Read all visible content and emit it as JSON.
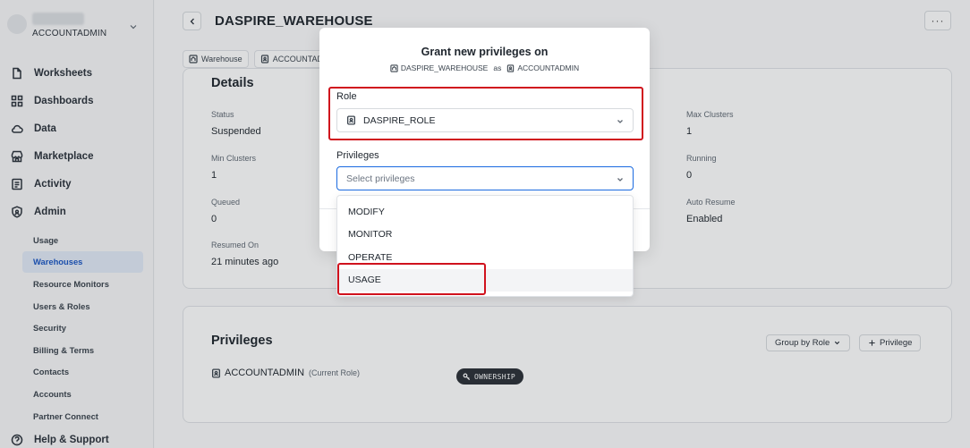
{
  "sidebar": {
    "account_role": "ACCOUNTADMIN",
    "nav": [
      {
        "label": "Worksheets",
        "icon": "worksheet-icon"
      },
      {
        "label": "Dashboards",
        "icon": "dashboard-icon"
      },
      {
        "label": "Data",
        "icon": "cloud-icon"
      },
      {
        "label": "Marketplace",
        "icon": "store-icon"
      },
      {
        "label": "Activity",
        "icon": "activity-icon"
      },
      {
        "label": "Admin",
        "icon": "shield-icon"
      }
    ],
    "admin_items": [
      "Usage",
      "Warehouses",
      "Resource Monitors",
      "Users & Roles",
      "Security",
      "Billing & Terms",
      "Contacts",
      "Accounts",
      "Partner Connect"
    ],
    "active_admin_item": "Warehouses",
    "help_label": "Help & Support"
  },
  "header": {
    "title": "DASPIRE_WAREHOUSE",
    "more_label": "···"
  },
  "breadcrumb": {
    "warehouse_label": "Warehouse",
    "role_label": "ACCOUNTAD"
  },
  "details": {
    "title": "Details",
    "fields": [
      {
        "label": "Status",
        "value": "Suspended"
      },
      {
        "label": "Min Clusters",
        "value": "1"
      },
      {
        "label": "Queued",
        "value": "0"
      },
      {
        "label": "Resumed On",
        "value": "21 minutes ago"
      },
      {
        "label": "Max Clusters",
        "value": "1"
      },
      {
        "label": "Running",
        "value": "0"
      },
      {
        "label": "Auto Resume",
        "value": "Enabled"
      }
    ]
  },
  "privileges": {
    "title": "Privileges",
    "group_by_label": "Group by Role",
    "add_label": "Privilege",
    "row": {
      "role": "ACCOUNTADMIN",
      "note": "(Current Role)",
      "badge": "OWNERSHIP"
    }
  },
  "modal": {
    "title": "Grant new privileges on",
    "target": "DASPIRE_WAREHOUSE",
    "as_text": "as",
    "as_role": "ACCOUNTADMIN",
    "role_label": "Role",
    "role_value": "DASPIRE_ROLE",
    "privileges_label": "Privileges",
    "privileges_placeholder": "Select privileges",
    "options": [
      "MODIFY",
      "MONITOR",
      "OPERATE",
      "USAGE"
    ],
    "hovered_option": "USAGE"
  },
  "colors": {
    "highlight": "#d0121d",
    "active_nav_bg": "#e2eaf7",
    "active_nav_text": "#1a56c4",
    "focus_border": "#1a6ae0"
  }
}
